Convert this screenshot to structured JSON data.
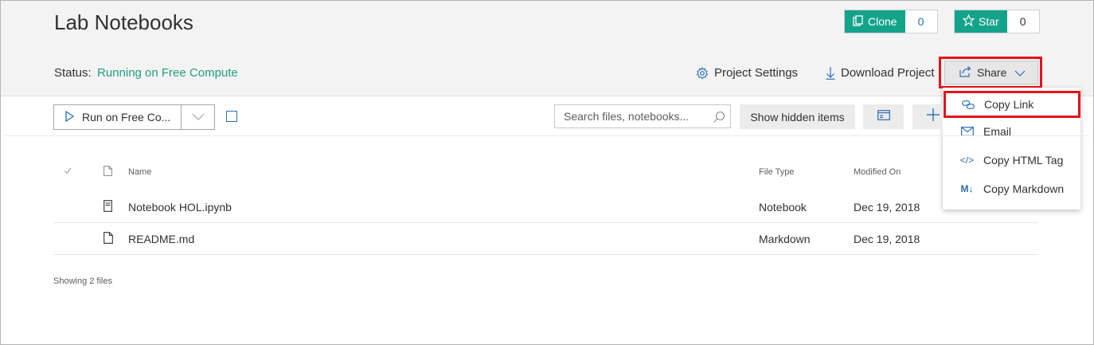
{
  "project": {
    "title": "Lab Notebooks",
    "status_label": "Status:",
    "status_value": "Running on Free Compute"
  },
  "header_actions": {
    "clone_label": "Clone",
    "clone_count": "0",
    "star_label": "Star",
    "star_count": "0",
    "project_settings": "Project Settings",
    "download_project": "Download Project",
    "share": "Share"
  },
  "share_menu": {
    "items": [
      {
        "label": "Copy Link",
        "icon": "link-icon"
      },
      {
        "label": "Email",
        "icon": "mail-icon"
      },
      {
        "label": "Copy HTML Tag",
        "icon": "code-icon"
      },
      {
        "label": "Copy Markdown",
        "icon": "markdown-icon"
      }
    ],
    "markdown_glyph": "M↓",
    "code_glyph": "</>"
  },
  "toolbar": {
    "run_label": "Run on Free Co...",
    "search_placeholder": "Search files, notebooks...",
    "show_hidden": "Show hidden items"
  },
  "table": {
    "columns": [
      "Name",
      "File Type",
      "Modified On"
    ],
    "rows": [
      {
        "name": "Notebook HOL.ipynb",
        "type": "Notebook",
        "modified": "Dec 19, 2018",
        "icon": "notebook-icon"
      },
      {
        "name": "README.md",
        "type": "Markdown",
        "modified": "Dec 19, 2018",
        "icon": "file-icon"
      }
    ]
  },
  "footer": {
    "count_text": "Showing 2 files"
  },
  "colors": {
    "accent_green": "#13a38b",
    "status_green": "#1f9e7f",
    "link_blue": "#2b6fb0",
    "highlight_red": "#e3141b"
  }
}
